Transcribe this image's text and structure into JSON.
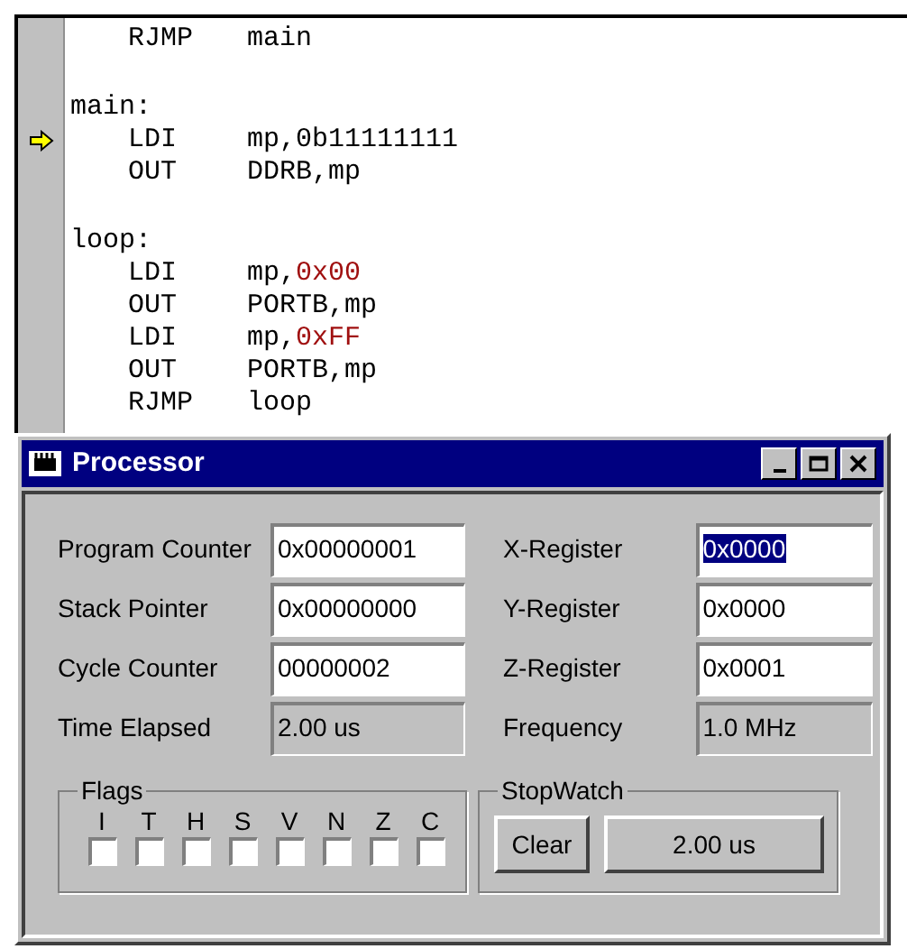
{
  "code": {
    "lines": [
      {
        "kind": "instr",
        "current": false,
        "op": "RJMP",
        "args": [
          {
            "text": "main",
            "kind": "plain"
          }
        ]
      },
      {
        "kind": "blank"
      },
      {
        "kind": "label",
        "text": "main:"
      },
      {
        "kind": "instr",
        "current": true,
        "op": "LDI",
        "args": [
          {
            "text": "mp,0b11111111",
            "kind": "plain"
          }
        ]
      },
      {
        "kind": "instr",
        "current": false,
        "op": "OUT",
        "args": [
          {
            "text": "DDRB,mp",
            "kind": "plain"
          }
        ]
      },
      {
        "kind": "blank"
      },
      {
        "kind": "label",
        "text": "loop:"
      },
      {
        "kind": "instr",
        "current": false,
        "op": "LDI",
        "args": [
          {
            "text": "mp,",
            "kind": "plain"
          },
          {
            "text": "0x00",
            "kind": "number"
          }
        ]
      },
      {
        "kind": "instr",
        "current": false,
        "op": "OUT",
        "args": [
          {
            "text": "PORTB,mp",
            "kind": "plain"
          }
        ]
      },
      {
        "kind": "instr",
        "current": false,
        "op": "LDI",
        "args": [
          {
            "text": "mp,",
            "kind": "plain"
          },
          {
            "text": "0xFF",
            "kind": "number"
          }
        ]
      },
      {
        "kind": "instr",
        "current": false,
        "op": "OUT",
        "args": [
          {
            "text": "PORTB,mp",
            "kind": "plain"
          }
        ]
      },
      {
        "kind": "instr",
        "current": false,
        "op": "RJMP",
        "args": [
          {
            "text": "loop",
            "kind": "plain"
          }
        ]
      }
    ]
  },
  "window": {
    "title": "Processor"
  },
  "fields": [
    {
      "label": "Program Counter",
      "value": "0x00000001",
      "kind": "edit",
      "selected": false
    },
    {
      "label": "X-Register",
      "value": "0x0000",
      "kind": "edit",
      "selected": true
    },
    {
      "label": "Stack Pointer",
      "value": "0x00000000",
      "kind": "edit",
      "selected": false
    },
    {
      "label": "Y-Register",
      "value": "0x0000",
      "kind": "edit",
      "selected": false
    },
    {
      "label": "Cycle Counter",
      "value": "00000002",
      "kind": "edit",
      "selected": false
    },
    {
      "label": "Z-Register",
      "value": "0x0001",
      "kind": "edit",
      "selected": false
    },
    {
      "label": "Time Elapsed",
      "value": "2.00 us",
      "kind": "readonly",
      "selected": false
    },
    {
      "label": "Frequency",
      "value": "1.0 MHz",
      "kind": "readonly",
      "selected": false
    }
  ],
  "flags": {
    "title": "Flags",
    "items": [
      {
        "label": "I",
        "checked": false
      },
      {
        "label": "T",
        "checked": false
      },
      {
        "label": "H",
        "checked": false
      },
      {
        "label": "S",
        "checked": false
      },
      {
        "label": "V",
        "checked": false
      },
      {
        "label": "N",
        "checked": false
      },
      {
        "label": "Z",
        "checked": false
      },
      {
        "label": "C",
        "checked": false
      }
    ]
  },
  "stopwatch": {
    "title": "StopWatch",
    "clear_button": "Clear",
    "time_button": "2.00 us"
  }
}
